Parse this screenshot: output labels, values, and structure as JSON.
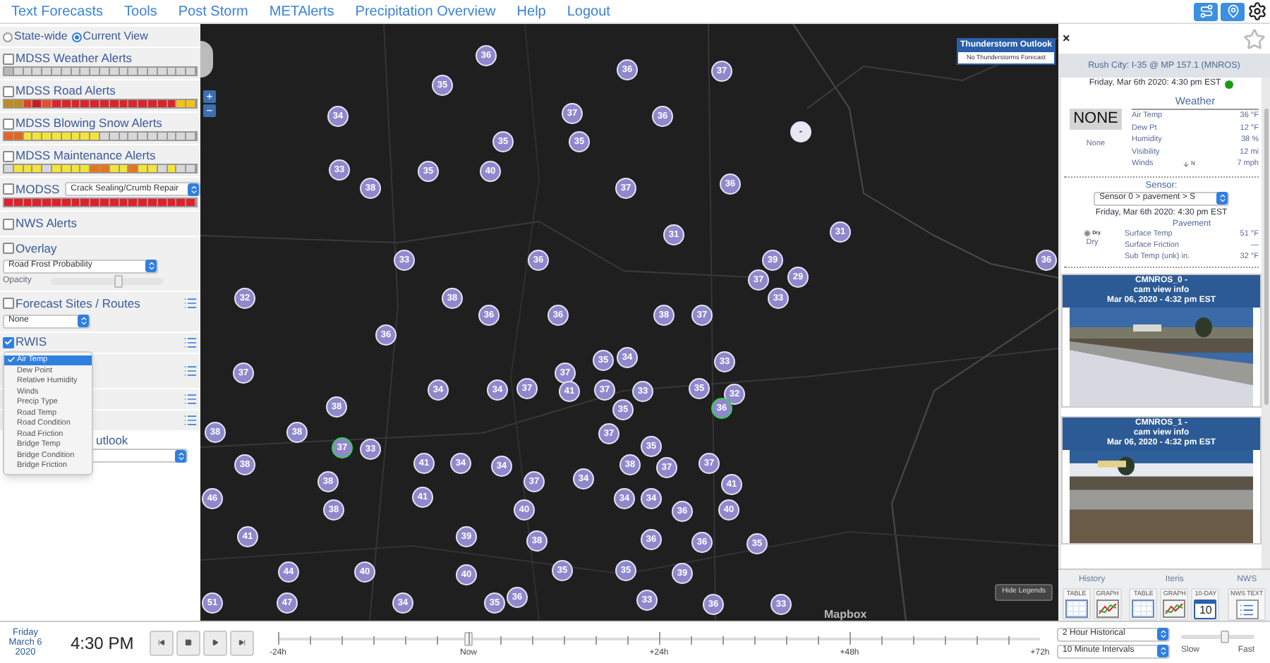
{
  "nav": {
    "links": [
      "Text Forecasts",
      "Tools",
      "Post Storm",
      "METAlerts",
      "Precipitation Overview",
      "Help",
      "Logout"
    ]
  },
  "left": {
    "scope": [
      {
        "label": "State-wide",
        "selected": false
      },
      {
        "label": "Current View",
        "selected": true
      }
    ],
    "layers": [
      {
        "label": "MDSS Weather Alerts",
        "checked": false,
        "cells": [
          {
            "color": "#b8b8b8"
          },
          {
            "color": "#d8d8d8"
          },
          {
            "color": "#d8d8d8"
          },
          {
            "color": "#d8d8d8"
          },
          {
            "color": "#d8d8d8"
          },
          {
            "color": "#d8d8d8"
          },
          {
            "color": "#d8d8d8"
          },
          {
            "color": "#d8d8d8"
          },
          {
            "color": "#d8d8d8"
          },
          {
            "color": "#d8d8d8"
          },
          {
            "color": "#d8d8d8"
          },
          {
            "color": "#d8d8d8"
          },
          {
            "color": "#d8d8d8"
          },
          {
            "color": "#d8d8d8"
          },
          {
            "color": "#d8d8d8"
          },
          {
            "color": "#d8d8d8"
          },
          {
            "color": "#d8d8d8"
          },
          {
            "color": "#d8d8d8"
          },
          {
            "color": "#d8d8d8"
          },
          {
            "color": "#d8d8d8"
          }
        ]
      },
      {
        "label": "MDSS Road Alerts",
        "checked": false,
        "cells": [
          {
            "color": "#c08a1c"
          },
          {
            "color": "#c08a1c"
          },
          {
            "color": "#e0402c"
          },
          {
            "color": "#c81e1e"
          },
          {
            "color": "#e4502e"
          },
          {
            "color": "#d8262a"
          },
          {
            "color": "#d8262a"
          },
          {
            "color": "#d8262a"
          },
          {
            "color": "#d8262a"
          },
          {
            "color": "#d8262a"
          },
          {
            "color": "#d8262a"
          },
          {
            "color": "#d8262a"
          },
          {
            "color": "#d8262a"
          },
          {
            "color": "#d8262a"
          },
          {
            "color": "#d8262a"
          },
          {
            "color": "#d8262a"
          },
          {
            "color": "#d8262a"
          },
          {
            "color": "#d8262a"
          },
          {
            "color": "#f2c31c"
          },
          {
            "color": "#f2c31c"
          }
        ]
      },
      {
        "label": "MDSS Blowing Snow Alerts",
        "checked": false,
        "cells": [
          {
            "color": "#e8641c"
          },
          {
            "color": "#e8641c"
          },
          {
            "color": "#f4e43a"
          },
          {
            "color": "#f4e43a"
          },
          {
            "color": "#f4e43a"
          },
          {
            "color": "#f4e43a"
          },
          {
            "color": "#f4e43a"
          },
          {
            "color": "#f4e43a"
          },
          {
            "color": "#f4e43a"
          },
          {
            "color": "#f4e43a"
          },
          {
            "color": "#d8d8d8"
          },
          {
            "color": "#d8d8d8"
          },
          {
            "color": "#d8d8d8"
          },
          {
            "color": "#d8d8d8"
          },
          {
            "color": "#d8d8d8"
          },
          {
            "color": "#d8d8d8"
          },
          {
            "color": "#d8d8d8"
          },
          {
            "color": "#d8d8d8"
          },
          {
            "color": "#d8d8d8"
          },
          {
            "color": "#d8d8d8"
          }
        ]
      },
      {
        "label": "MDSS Maintenance Alerts",
        "checked": false,
        "cells": [
          {
            "color": "#d8d8d8"
          },
          {
            "color": "#f4e43a"
          },
          {
            "color": "#f4e43a"
          },
          {
            "color": "#f4e43a"
          },
          {
            "color": "#d8d8d8"
          },
          {
            "color": "#f4e43a"
          },
          {
            "color": "#f4e43a"
          },
          {
            "color": "#f4e43a"
          },
          {
            "color": "#f4e43a"
          },
          {
            "color": "#e8741c"
          },
          {
            "color": "#e8741c"
          },
          {
            "color": "#f4e43a"
          },
          {
            "color": "#f4e43a"
          },
          {
            "color": "#e8741c"
          },
          {
            "color": "#f4e43a"
          },
          {
            "color": "#f4e43a"
          },
          {
            "color": "#d8d8d8"
          },
          {
            "color": "#f4e43a"
          },
          {
            "color": "#d8d8d8"
          },
          {
            "color": "#d8d8d8"
          }
        ]
      },
      {
        "label": "MODSS",
        "checked": false,
        "select": "Crack Sealing/Crumb Repair",
        "cells": [
          {
            "color": "#e0202a"
          },
          {
            "color": "#e0202a"
          },
          {
            "color": "#e0202a"
          },
          {
            "color": "#e0202a"
          },
          {
            "color": "#e0202a"
          },
          {
            "color": "#e0202a"
          },
          {
            "color": "#e0202a"
          },
          {
            "color": "#e0202a"
          },
          {
            "color": "#e0202a"
          },
          {
            "color": "#e0202a"
          },
          {
            "color": "#e0202a"
          },
          {
            "color": "#e0202a"
          },
          {
            "color": "#e0202a"
          },
          {
            "color": "#e0202a"
          },
          {
            "color": "#e0202a"
          },
          {
            "color": "#e0202a"
          },
          {
            "color": "#e0202a"
          },
          {
            "color": "#e0202a"
          },
          {
            "color": "#e0202a"
          },
          {
            "color": "#e0202a"
          }
        ]
      }
    ],
    "nws": {
      "label": "NWS Alerts",
      "checked": false
    },
    "overlay": {
      "label": "Overlay",
      "checked": false,
      "select": "Road Frost Probability",
      "opacity_label": "Opacity",
      "level": 0.6
    },
    "forecast": {
      "label": "Forecast Sites / Routes",
      "checked": false,
      "select": "None"
    },
    "rwis": {
      "label": "RWIS",
      "checked": true
    },
    "partial_label": "utlook",
    "dropdown": [
      {
        "label": "Air Temp",
        "selected": true
      },
      {
        "label": "Dew Point",
        "selected": false
      },
      {
        "label": "Relative Humidity",
        "selected": false
      },
      {
        "label": "Winds",
        "selected": false
      },
      {
        "label": "Precip Type",
        "selected": false
      },
      {
        "label": "Road Temp",
        "selected": false
      },
      {
        "label": "Road Condition",
        "selected": false
      },
      {
        "label": "Road Friction",
        "selected": false
      },
      {
        "label": "Bridge Temp",
        "selected": false
      },
      {
        "label": "Bridge Condition",
        "selected": false
      },
      {
        "label": "Bridge Friction",
        "selected": false
      }
    ]
  },
  "map": {
    "zoom_in": "+",
    "zoom_out": "−",
    "legend": {
      "title": "Thunderstorm Outlook",
      "text": "No Thunderstorms Forecast"
    },
    "hide_legends": "Hide Legends",
    "logo": "Mapbox",
    "markers": [
      {
        "label": "36",
        "highlighted": false
      },
      {
        "label": "36",
        "highlighted": false
      },
      {
        "label": "37",
        "highlighted": false
      },
      {
        "label": "35",
        "highlighted": false
      },
      {
        "label": "34",
        "highlighted": false
      },
      {
        "label": "37",
        "highlighted": false
      },
      {
        "label": "36",
        "highlighted": false
      },
      {
        "label": "-",
        "highlighted": false
      },
      {
        "label": "35",
        "highlighted": false
      },
      {
        "label": "35",
        "highlighted": false
      },
      {
        "label": "33",
        "highlighted": false
      },
      {
        "label": "35",
        "highlighted": false
      },
      {
        "label": "40",
        "highlighted": false
      },
      {
        "label": "38",
        "highlighted": false
      },
      {
        "label": "37",
        "highlighted": false
      },
      {
        "label": "36",
        "highlighted": false
      },
      {
        "label": "31",
        "highlighted": false
      },
      {
        "label": "31",
        "highlighted": false
      },
      {
        "label": "33",
        "highlighted": false
      },
      {
        "label": "36",
        "highlighted": false
      },
      {
        "label": "39",
        "highlighted": false
      },
      {
        "label": "36",
        "highlighted": false
      },
      {
        "label": "37",
        "highlighted": false
      },
      {
        "label": "29",
        "highlighted": false
      },
      {
        "label": "32",
        "highlighted": false
      },
      {
        "label": "38",
        "highlighted": false
      },
      {
        "label": "33",
        "highlighted": false
      },
      {
        "label": "36",
        "highlighted": false
      },
      {
        "label": "36",
        "highlighted": false
      },
      {
        "label": "38",
        "highlighted": false
      },
      {
        "label": "37",
        "highlighted": false
      },
      {
        "label": "36",
        "highlighted": false
      },
      {
        "label": "35",
        "highlighted": false
      },
      {
        "label": "34",
        "highlighted": false
      },
      {
        "label": "33",
        "highlighted": false
      },
      {
        "label": "37",
        "highlighted": false
      },
      {
        "label": "37",
        "highlighted": false
      },
      {
        "label": "34",
        "highlighted": false
      },
      {
        "label": "34",
        "highlighted": false
      },
      {
        "label": "37",
        "highlighted": false
      },
      {
        "label": "41",
        "highlighted": false
      },
      {
        "label": "37",
        "highlighted": false
      },
      {
        "label": "33",
        "highlighted": false
      },
      {
        "label": "35",
        "highlighted": false
      },
      {
        "label": "32",
        "highlighted": false
      },
      {
        "label": "38",
        "highlighted": false
      },
      {
        "label": "35",
        "highlighted": false
      },
      {
        "label": "36",
        "highlighted": true
      },
      {
        "label": "38",
        "highlighted": false
      },
      {
        "label": "38",
        "highlighted": false
      },
      {
        "label": "37",
        "highlighted": false
      },
      {
        "label": "37",
        "highlighted": true
      },
      {
        "label": "33",
        "highlighted": false
      },
      {
        "label": "35",
        "highlighted": false
      },
      {
        "label": "38",
        "highlighted": false
      },
      {
        "label": "41",
        "highlighted": false
      },
      {
        "label": "34",
        "highlighted": false
      },
      {
        "label": "34",
        "highlighted": false
      },
      {
        "label": "38",
        "highlighted": false
      },
      {
        "label": "37",
        "highlighted": false
      },
      {
        "label": "37",
        "highlighted": false
      },
      {
        "label": "38",
        "highlighted": false
      },
      {
        "label": "37",
        "highlighted": false
      },
      {
        "label": "34",
        "highlighted": false
      },
      {
        "label": "41",
        "highlighted": false
      },
      {
        "label": "46",
        "highlighted": false
      },
      {
        "label": "41",
        "highlighted": false
      },
      {
        "label": "34",
        "highlighted": false
      },
      {
        "label": "34",
        "highlighted": false
      },
      {
        "label": "38",
        "highlighted": false
      },
      {
        "label": "40",
        "highlighted": false
      },
      {
        "label": "36",
        "highlighted": false
      },
      {
        "label": "40",
        "highlighted": false
      },
      {
        "label": "41",
        "highlighted": false
      },
      {
        "label": "39",
        "highlighted": false
      },
      {
        "label": "38",
        "highlighted": false
      },
      {
        "label": "36",
        "highlighted": false
      },
      {
        "label": "36",
        "highlighted": false
      },
      {
        "label": "35",
        "highlighted": false
      },
      {
        "label": "44",
        "highlighted": false
      },
      {
        "label": "40",
        "highlighted": false
      },
      {
        "label": "40",
        "highlighted": false
      },
      {
        "label": "35",
        "highlighted": false
      },
      {
        "label": "35",
        "highlighted": false
      },
      {
        "label": "39",
        "highlighted": false
      },
      {
        "label": "51",
        "highlighted": false
      },
      {
        "label": "47",
        "highlighted": false
      },
      {
        "label": "34",
        "highlighted": false
      },
      {
        "label": "35",
        "highlighted": false
      },
      {
        "label": "36",
        "highlighted": false
      },
      {
        "label": "33",
        "highlighted": false
      },
      {
        "label": "36",
        "highlighted": false
      },
      {
        "label": "33",
        "highlighted": false
      }
    ]
  },
  "station": {
    "close": "×",
    "title": "Rush City: I-35 @ MP 157.1 (MNROS)",
    "time": "Friday, Mar 6th 2020: 4:30 pm EST",
    "alert": "NONE",
    "alert_caption": "None",
    "weather_heading": "Weather",
    "weather": [
      {
        "name": "Air Temp",
        "value": "36 °F"
      },
      {
        "name": "Dew Pt",
        "value": "12 °F"
      },
      {
        "name": "Humidity",
        "value": "38 %"
      },
      {
        "name": "Visibility",
        "value": "12 mi"
      },
      {
        "name": "Winds",
        "dir": "N",
        "value": "7 mph"
      }
    ],
    "sensor_label": "Sensor:",
    "sensor_select": "Sensor 0 > pavement > S",
    "sensor_time": "Friday, Mar 6th 2020: 4:30 pm EST",
    "surface_icon_label": "Dry",
    "surface": "Dry",
    "pavement_heading": "Pavement",
    "pavement": [
      {
        "name": "Surface Temp",
        "value": "51 °F"
      },
      {
        "name": "Surface Friction",
        "value": "—"
      },
      {
        "name": "Sub Temp (unk) in.",
        "value": "32 °F"
      }
    ],
    "cameras": [
      {
        "title": "CMNROS_0 -",
        "subtitle": "cam view info",
        "time": "Mar 06, 2020 - 4:32 pm EST"
      },
      {
        "title": "CMNROS_1 -",
        "subtitle": "cam view info",
        "time": "Mar 06, 2020 - 4:32 pm EST"
      }
    ],
    "tools": [
      {
        "heading": "History",
        "buttons": [
          {
            "kind": "table",
            "label": "TABLE"
          },
          {
            "kind": "graph",
            "label": "GRAPH"
          }
        ]
      },
      {
        "heading": "Iteris",
        "buttons": [
          {
            "kind": "table",
            "label": "TABLE"
          },
          {
            "kind": "graph",
            "label": "GRAPH"
          },
          {
            "kind": "calendar",
            "label": "10-DAY",
            "day": "10"
          }
        ]
      },
      {
        "heading": "NWS",
        "buttons": [
          {
            "kind": "text",
            "label": "NWS TEXT"
          }
        ]
      }
    ]
  },
  "timebar": {
    "date": [
      "Friday",
      "March 6",
      "2020"
    ],
    "time": "4:30 PM",
    "ticks": [
      "-24h",
      "Now",
      "+24h",
      "+48h",
      "+72h"
    ],
    "level": 0.25,
    "range_select": "2 Hour Historical",
    "interval_select": "10 Minute Intervals",
    "speed": {
      "slow": "Slow",
      "fast": "Fast",
      "level": 0.6
    }
  }
}
